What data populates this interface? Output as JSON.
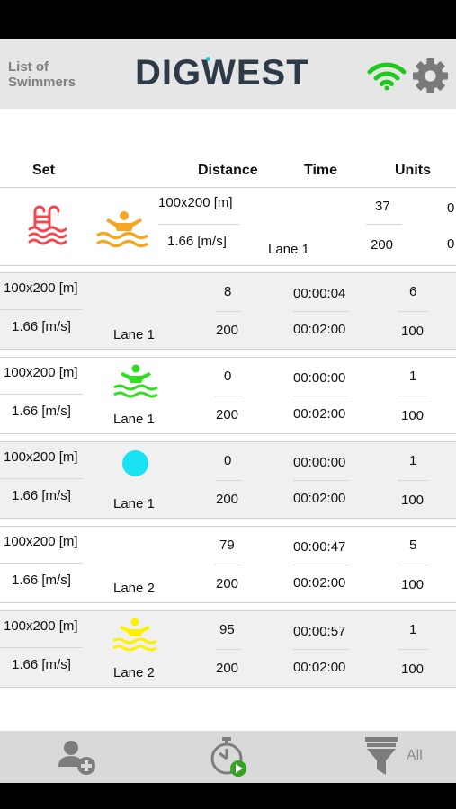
{
  "header": {
    "back_label_line1": "List of",
    "back_label_line2": "Swimmers",
    "logo_text": "DIGWEST",
    "wifi_color": "#1ec81e",
    "gear_color": "#7a7a7a"
  },
  "columns": {
    "set": "Set",
    "distance": "Distance",
    "time": "Time",
    "units": "Units"
  },
  "rows": [
    {
      "icon": "pool-ladder-icon",
      "swimmer": "swimmer-orange",
      "set": "100x200 [m]",
      "speed": "1.66 [m/s]",
      "lane": "Lane 1",
      "distance_top": "",
      "distance_bottom": "",
      "time_top": "",
      "time_bottom": "",
      "units_top": "37",
      "units_bottom": "200",
      "extra_top": "0",
      "extra_bottom": "0"
    },
    {
      "icon": "",
      "set": "100x200 [m]",
      "speed": "1.66 [m/s]",
      "lane": "Lane 1",
      "distance_top": "8",
      "distance_bottom": "200",
      "time_top": "00:00:04",
      "time_bottom": "00:02:00",
      "units_top": "6",
      "units_bottom": "100"
    },
    {
      "icon": "swimmer-green",
      "set": "100x200 [m]",
      "speed": "1.66 [m/s]",
      "lane": "Lane 1",
      "distance_top": "0",
      "distance_bottom": "200",
      "time_top": "00:00:00",
      "time_bottom": "00:02:00",
      "units_top": "1",
      "units_bottom": "100"
    },
    {
      "icon": "cyan-dot",
      "set": "100x200 [m]",
      "speed": "1.66 [m/s]",
      "lane": "Lane 1",
      "distance_top": "0",
      "distance_bottom": "200",
      "time_top": "00:00:00",
      "time_bottom": "00:02:00",
      "units_top": "1",
      "units_bottom": "100"
    },
    {
      "icon": "",
      "set": "100x200 [m]",
      "speed": "1.66 [m/s]",
      "lane": "Lane 2",
      "distance_top": "79",
      "distance_bottom": "200",
      "time_top": "00:00:47",
      "time_bottom": "00:02:00",
      "units_top": "5",
      "units_bottom": "100"
    },
    {
      "icon": "swimmer-yellow",
      "set": "100x200 [m]",
      "speed": "1.66 [m/s]",
      "lane": "Lane 2",
      "distance_top": "95",
      "distance_bottom": "200",
      "time_top": "00:00:57",
      "time_bottom": "00:02:00",
      "units_top": "1",
      "units_bottom": "100"
    }
  ],
  "colors": {
    "pool_red": "#f2474c",
    "swimmer_orange": "#f5a623",
    "swimmer_green": "#33dd22",
    "dot_cyan": "#19e3f2",
    "swimmer_yellow": "#fff000"
  },
  "footer": {
    "filter_label": "All"
  }
}
